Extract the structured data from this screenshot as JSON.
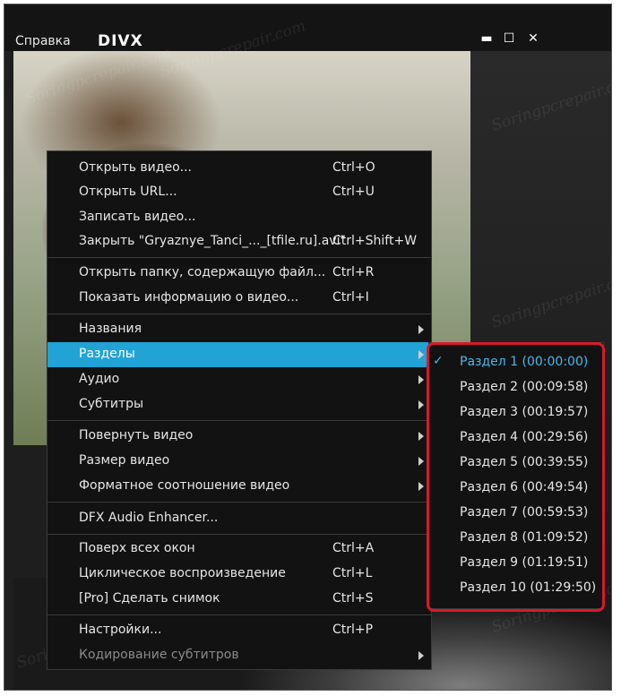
{
  "titlebar": {
    "menu_help": "Справка",
    "logo_text": "DIVX",
    "minimize": "▬",
    "maximize": "☐",
    "close": "✕"
  },
  "context_menu": {
    "open_video": {
      "label": "Открыть видео...",
      "shortcut": "Ctrl+O"
    },
    "open_url": {
      "label": "Открыть URL...",
      "shortcut": "Ctrl+U"
    },
    "record_video": {
      "label": "Записать видео..."
    },
    "close_file": {
      "label": "Закрыть \"Gryaznye_Tanci_..._[tfile.ru].avi\"",
      "shortcut": "Ctrl+Shift+W"
    },
    "open_folder": {
      "label": "Открыть папку, содержащую файл...",
      "shortcut": "Ctrl+R"
    },
    "show_info": {
      "label": "Показать информацию о видео...",
      "shortcut": "Ctrl+I"
    },
    "titles": {
      "label": "Названия"
    },
    "chapters": {
      "label": "Разделы"
    },
    "audio": {
      "label": "Аудио"
    },
    "subtitles": {
      "label": "Субтитры"
    },
    "rotate": {
      "label": "Повернуть видео"
    },
    "video_size": {
      "label": "Размер видео"
    },
    "aspect_ratio": {
      "label": "Форматное соотношение видео"
    },
    "dfx": {
      "label": "DFX Audio Enhancer..."
    },
    "always_on_top": {
      "label": "Поверх всех окон",
      "shortcut": "Ctrl+A"
    },
    "loop": {
      "label": "Циклическое воспроизведение",
      "shortcut": "Ctrl+L"
    },
    "snapshot": {
      "label": "[Pro] Сделать снимок",
      "shortcut": "Ctrl+S"
    },
    "settings": {
      "label": "Настройки...",
      "shortcut": "Ctrl+P"
    },
    "subtitle_encoding": {
      "label": "Кодирование субтитров"
    }
  },
  "chapters_submenu": {
    "check": "✓",
    "items": [
      "Раздел 1 (00:00:00)",
      "Раздел 2 (00:09:58)",
      "Раздел 3 (00:19:57)",
      "Раздел 4 (00:29:56)",
      "Раздел 5 (00:39:55)",
      "Раздел 6 (00:49:54)",
      "Раздел 7 (00:59:53)",
      "Раздел 8 (01:09:52)",
      "Раздел 9 (01:19:51)",
      "Раздел 10 (01:29:50)"
    ]
  },
  "watermark": "Soringpcrepair.com",
  "colors": {
    "highlight": "#21a3d6",
    "active_text": "#4ab8ea",
    "outline": "#d8192a"
  }
}
